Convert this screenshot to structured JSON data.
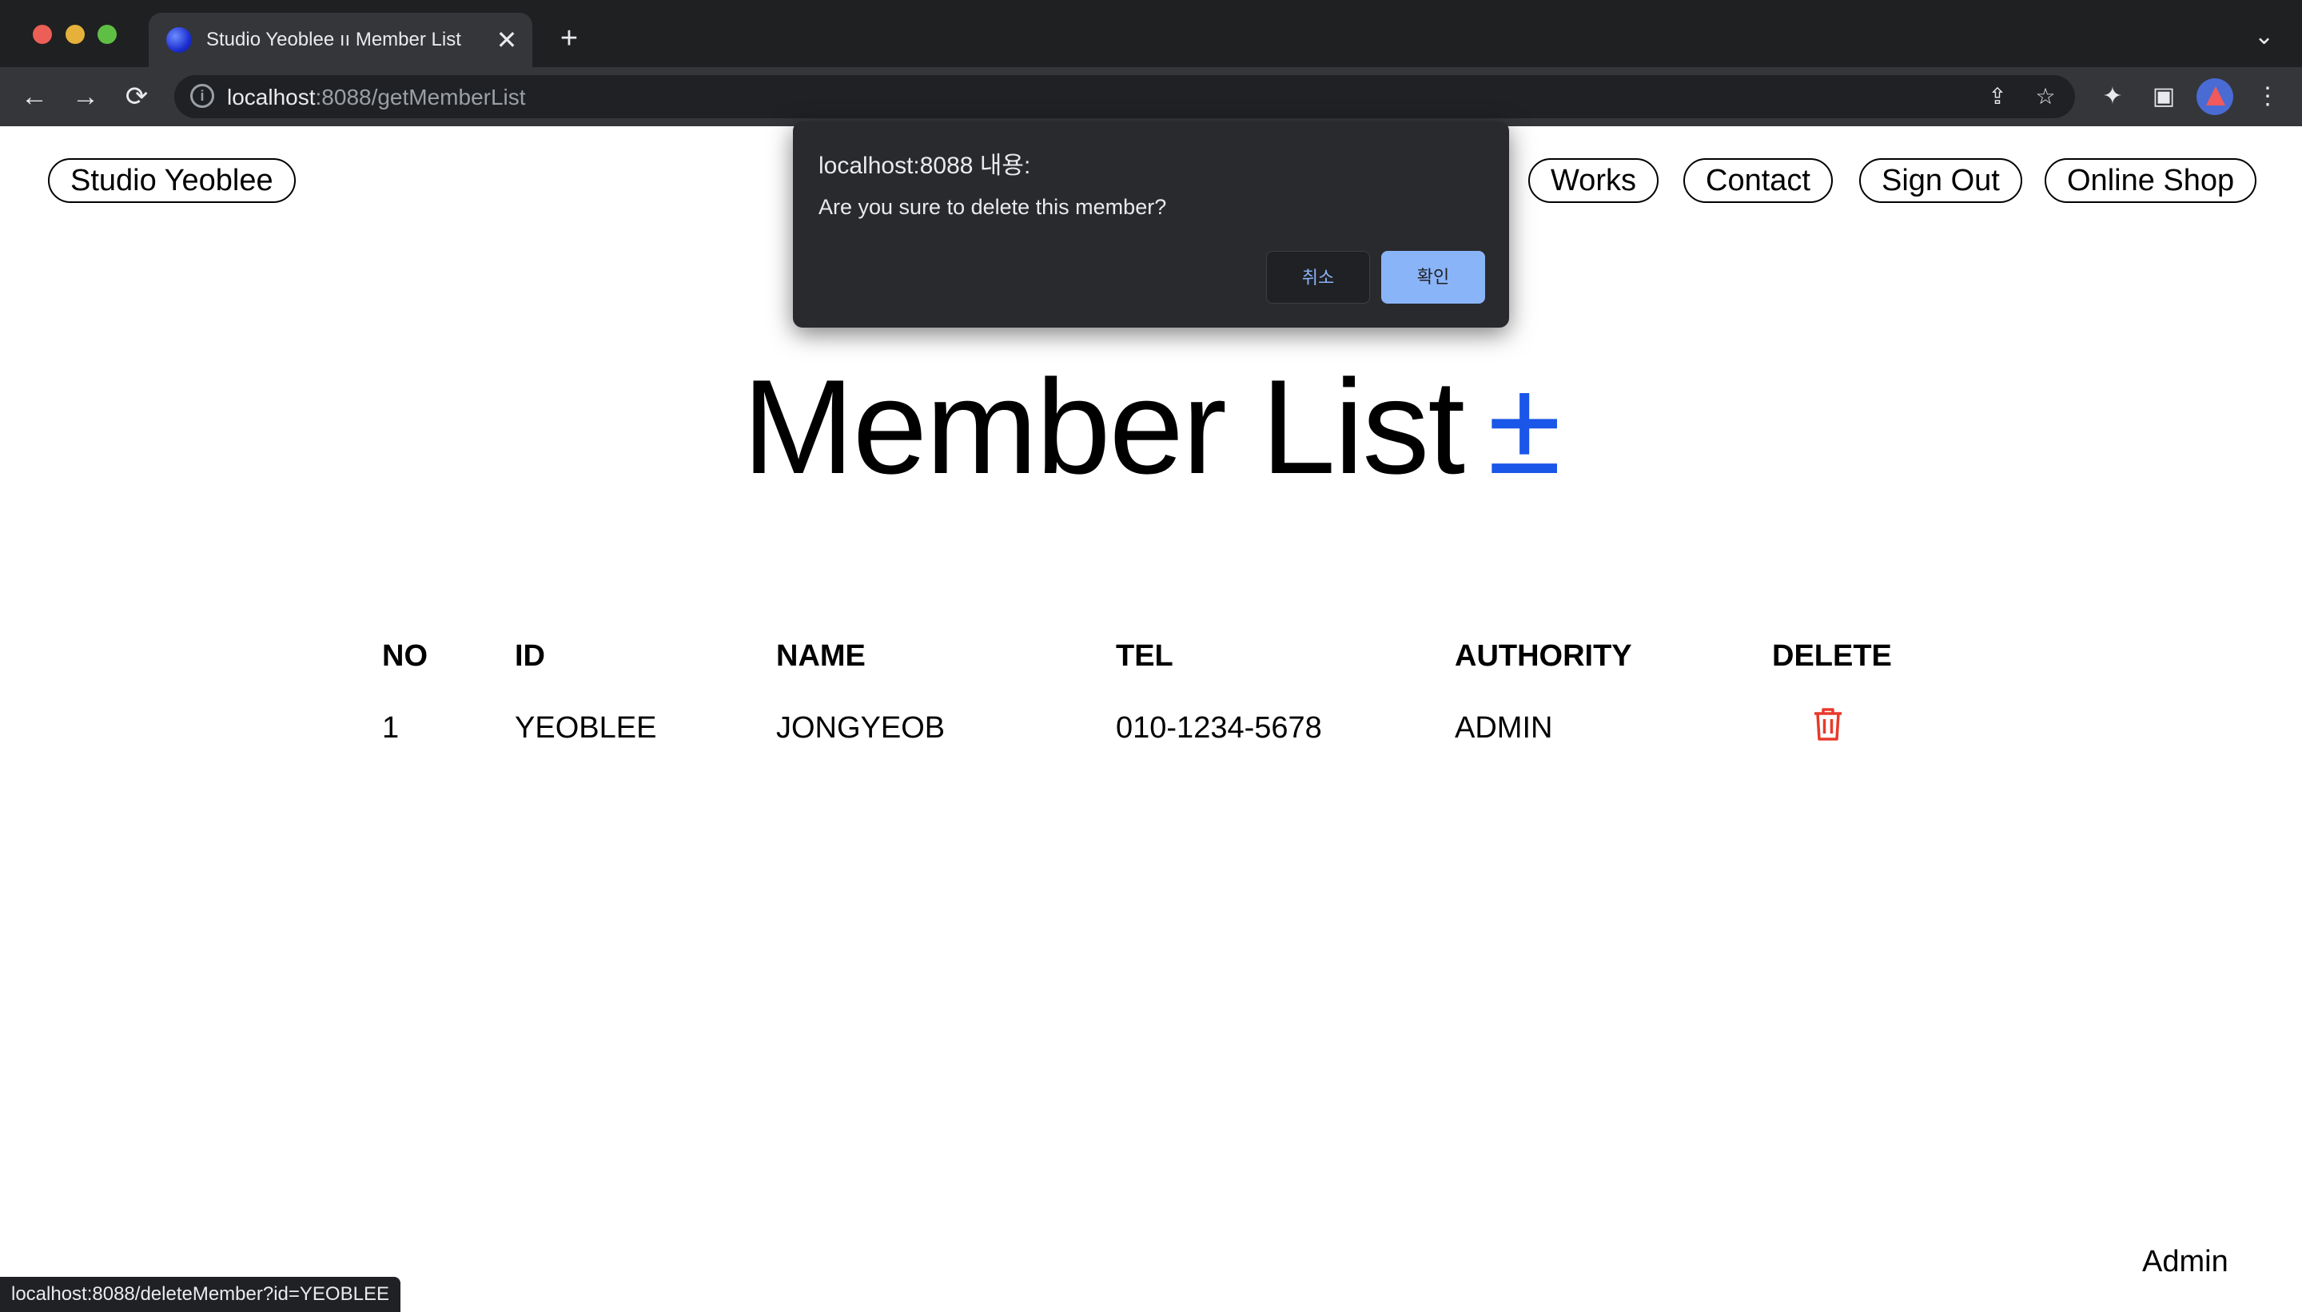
{
  "browser": {
    "tab_title": "Studio Yeoblee ıı Member List",
    "tab_close": "✕",
    "new_tab": "+",
    "tab_menu": "⌄",
    "url_host": "localhost",
    "url_rest": ":8088/getMemberList",
    "back": "←",
    "forward": "→",
    "reload": "⟳",
    "share_icon": "⇪",
    "star_icon": "☆",
    "extensions_icon": "✦",
    "sidepanel_icon": "▣",
    "menu_icon": "⋮"
  },
  "nav": {
    "brand": "Studio Yeoblee",
    "links": [
      "Works",
      "Contact",
      "Sign Out",
      "Online Shop"
    ]
  },
  "main": {
    "title": "Member List",
    "add_symbol": "±"
  },
  "table": {
    "headers": [
      "NO",
      "ID",
      "NAME",
      "TEL",
      "AUTHORITY",
      "DELETE"
    ],
    "rows": [
      {
        "no": "1",
        "id": "YEOBLEE",
        "name": "JONGYEOB",
        "tel": "010-1234-5678",
        "authority": "ADMIN"
      }
    ]
  },
  "dialog": {
    "title": "localhost:8088 내용:",
    "message": "Are you sure to delete this member?",
    "cancel": "취소",
    "ok": "확인"
  },
  "footer": {
    "user": "Admin"
  },
  "status_bar": {
    "link": "localhost:8088/deleteMember?id=YEOBLEE"
  },
  "colors": {
    "accent_blue": "#1a56e8",
    "delete_red": "#e8392b",
    "dialog_bg": "#292a2d",
    "dialog_ok": "#8ab4f8"
  }
}
